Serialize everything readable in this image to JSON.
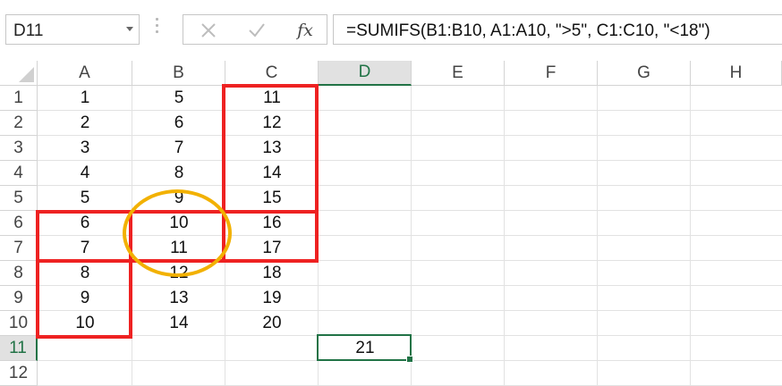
{
  "name_box": {
    "value": "D11"
  },
  "formula_bar": {
    "cancel_glyph": "✕",
    "enter_glyph": "✓",
    "fx_glyph": "fx",
    "formula": "=SUMIFS(B1:B10, A1:A10, \">5\", C1:C10, \"<18\")"
  },
  "columns": [
    "A",
    "B",
    "C",
    "D",
    "E",
    "F",
    "G",
    "H"
  ],
  "selected_column": "D",
  "rows": [
    "1",
    "2",
    "3",
    "4",
    "5",
    "6",
    "7",
    "8",
    "9",
    "10",
    "11",
    "12"
  ],
  "selected_row": "11",
  "cells": {
    "A": [
      "1",
      "2",
      "3",
      "4",
      "5",
      "6",
      "7",
      "8",
      "9",
      "10",
      "",
      ""
    ],
    "B": [
      "5",
      "6",
      "7",
      "8",
      "9",
      "10",
      "11",
      "12",
      "13",
      "14",
      "",
      ""
    ],
    "C": [
      "11",
      "12",
      "13",
      "14",
      "15",
      "16",
      "17",
      "18",
      "19",
      "20",
      "",
      ""
    ],
    "D": [
      "",
      "",
      "",
      "",
      "",
      "",
      "",
      "",
      "",
      "",
      "21",
      ""
    ]
  },
  "colors": {
    "selection": "#217346",
    "annotation_red": "#ee2222",
    "annotation_orange": "#f2b100"
  }
}
